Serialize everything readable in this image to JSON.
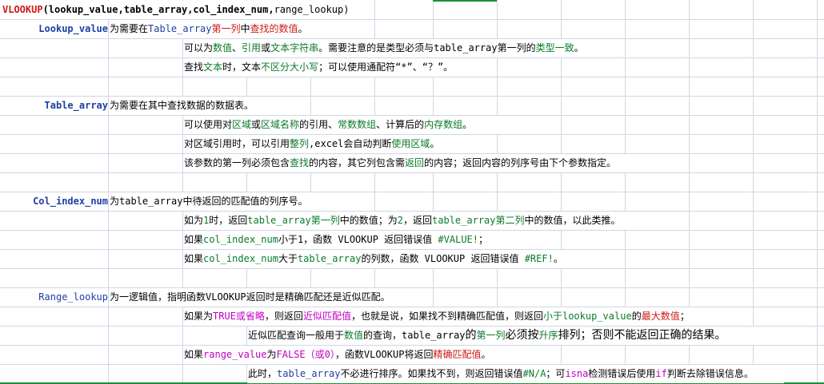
{
  "formula": {
    "fn": "VLOOKUP",
    "args": "(lookup_value,table_array,col_index_num,",
    "last": "range_lookup)"
  },
  "lookup_value": {
    "header": "Lookup_value",
    "row1": [
      "为需要在",
      "Table_array",
      "第一列",
      "中",
      "查找的数值",
      "。"
    ],
    "row2": [
      "可以为",
      "数值",
      "、",
      "引用",
      "或",
      "文本字符串",
      "。需要注意的是类型必须与table_array第一列的",
      "类型一致",
      "。"
    ],
    "row3": [
      "查找",
      "文本",
      "时，文本",
      "不区分大小写",
      "；可以使用通配符“*”、“？”。"
    ]
  },
  "table_array": {
    "header": "Table_array",
    "row1": [
      "为需要在其中查找数据的数据表。"
    ],
    "row2": [
      "可以使用对",
      "区域",
      "或",
      "区域名称",
      "的引用、",
      "常数数组",
      "、计算后的",
      "内存数组",
      "。"
    ],
    "row3": [
      "对区域引用时，可以引用",
      "整列",
      ",excel会自动判断",
      "使用区域",
      "。"
    ],
    "row4": [
      "该参数的第一列必须包含",
      "查找",
      "的内容，其它列包含需",
      "返回",
      "的内容；返回内容的列序号由下个参数指定。"
    ]
  },
  "col_index_num": {
    "header": "Col_index_num",
    "row1": [
      "为table_array中待返回的匹配值的列序号。"
    ],
    "row2": [
      "如为",
      "1",
      "时，返回",
      "table_array第一列",
      "中的数值；为",
      "2",
      "，返回",
      "table_array第二列",
      "中的数值，以此类推。"
    ],
    "row3": [
      "如果",
      "col_index_num",
      "小于1，函数 VLOOKUP 返回错误值 ",
      "#VALUE!",
      "；"
    ],
    "row4": [
      "如果",
      "col_index_num",
      "大于",
      "table_array",
      "的列数，函数 VLOOKUP 返回错误值 ",
      "#REF!",
      "。"
    ]
  },
  "range_lookup": {
    "header": "Range_lookup",
    "row1": [
      "为一逻辑值，指明函数VLOOKUP返回时是精确匹配还是近似匹配。"
    ],
    "row2": [
      "如果为",
      "TRUE或省略",
      "，则返回",
      "近似匹配值",
      "，也就是说，如果找不到精确匹配值，则返回",
      "小于",
      "lookup_value",
      "的",
      "最大数值",
      "；"
    ],
    "row3": [
      "近似匹配查询一般用于",
      "数值",
      "的查询，",
      "table_array",
      "的",
      "第一列",
      "必须按",
      "升序",
      "排列；否则不能返回正确的结果。"
    ],
    "row4": [
      "如果",
      "range_value",
      "为",
      "FALSE（或0）",
      "，函数VLOOKUP将返回",
      "精确匹配值",
      "。"
    ],
    "row5": [
      "此时，",
      "table_array",
      "不必进行排序。如果找不到，则返回错误值",
      "#N/A",
      "；可",
      "isna",
      "检测错误后使用",
      "if",
      "判断去除错误信息。"
    ]
  },
  "colors": {
    "red": "#d01818",
    "green": "#0a7a2a",
    "blue": "#1f3fa5",
    "magenta": "#c000c0",
    "grid": "#d0d7e5",
    "selection": "#1e8f36"
  }
}
